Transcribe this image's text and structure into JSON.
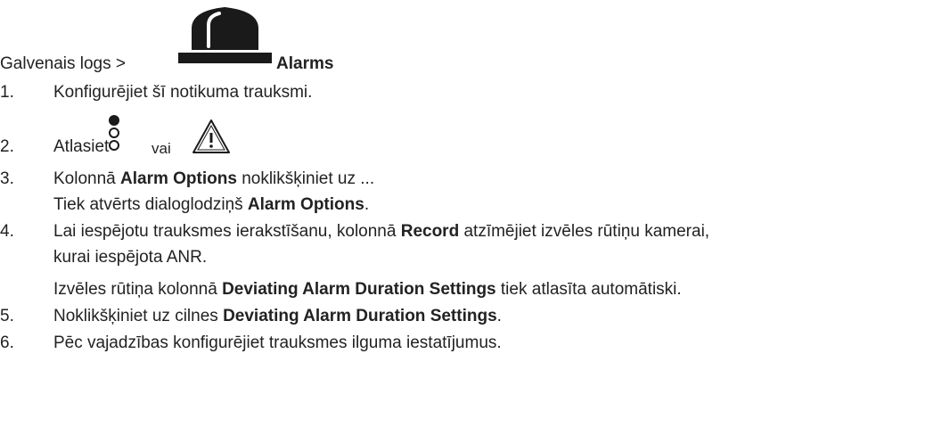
{
  "breadcrumb": {
    "prefix": "Galvenais logs >",
    "current": "Alarms"
  },
  "steps": [
    {
      "num": "1.",
      "text": "Konfigurējiet šī notikuma trauksmi."
    },
    {
      "num": "2.",
      "prefix": "Atlasiet",
      "middle": "vai",
      "icons": [
        "alarm-states-icon",
        "warning-triangle-icon"
      ]
    },
    {
      "num": "3.",
      "t1": "Kolonnā",
      "b1": "Alarm Options",
      "t2": "noklikšķiniet uz ...",
      "sub_t1": "Tiek atvērts dialoglodziņš",
      "sub_b1": "Alarm Options",
      "sub_t2": "."
    },
    {
      "num": "4.",
      "t1": "Lai iespējotu trauksmes ierakstīšanu, kolonnā",
      "b1": "Record",
      "t2": "atzīmējiet izvēles rūtiņu kamerai,",
      "line2": "kurai iespējota ANR.",
      "sub_t1": "Izvēles rūtiņa kolonnā",
      "sub_b1": "Deviating Alarm Duration Settings",
      "sub_t2": "tiek atlasīta automātiski."
    },
    {
      "num": "5.",
      "t1": "Noklikšķiniet uz cilnes",
      "b1": "Deviating Alarm Duration Settings",
      "t2": "."
    },
    {
      "num": "6.",
      "text": "Pēc vajadzības konfigurējiet trauksmes ilguma iestatījumus."
    }
  ],
  "colors": {
    "text": "#222222",
    "icon": "#1a1a1a"
  }
}
